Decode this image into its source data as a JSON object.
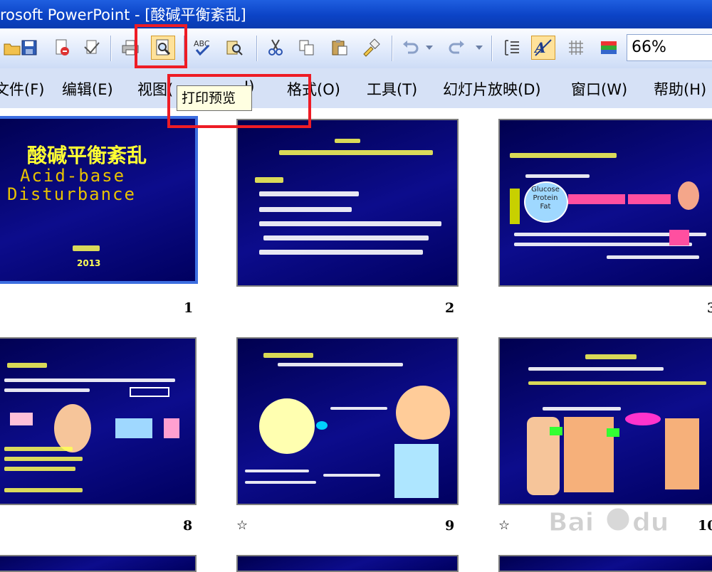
{
  "window": {
    "title": "rosoft PowerPoint - [酸碱平衡紊乱]"
  },
  "toolbar": {
    "buttons": [
      "open-icon",
      "save-icon",
      "permission-icon",
      "email-icon",
      "print-icon",
      "print-preview-icon",
      "spelling-icon",
      "research-icon",
      "cut-icon",
      "copy-icon",
      "paste-icon",
      "format-painter-icon",
      "undo-icon",
      "redo-icon",
      "expand-icon",
      "color-grayscale-icon",
      "grid-icon",
      "color-icon"
    ],
    "zoom": "66%"
  },
  "menu": {
    "items": [
      "文件(F)",
      "编辑(E)",
      "视图(",
      "I)",
      "格式(O)",
      "工具(T)",
      "幻灯片放映(D)",
      "窗口(W)",
      "帮助(H)"
    ]
  },
  "tooltip": {
    "text": "打印预览"
  },
  "slides": {
    "numbers": [
      "1",
      "2",
      "3",
      "8",
      "9",
      "10"
    ],
    "s1_title": "酸碱平衡紊乱",
    "s1_sub1": "Acid-base",
    "s1_sub2": "Disturbance",
    "s1_year": "2013",
    "s3_text": "Glucose Protein Fat",
    "star": "☆"
  },
  "colors": {
    "highlight": "#ee1c25",
    "slide_bg": "#0c0c8c",
    "title_yellow": "#ffff33"
  }
}
